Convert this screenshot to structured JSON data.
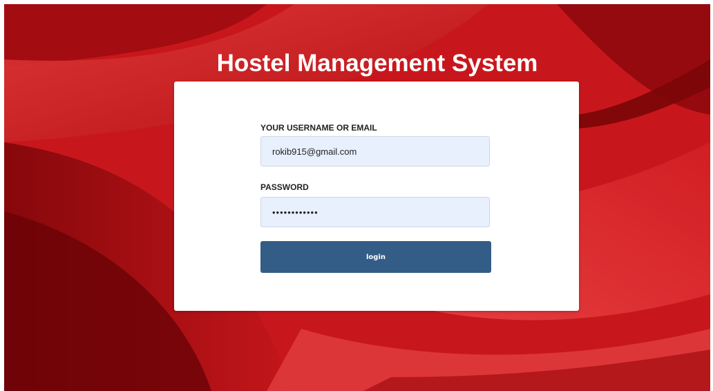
{
  "header": {
    "title": "Hostel Management System"
  },
  "login_form": {
    "username_label": "YOUR USERNAME OR EMAIL",
    "username_value": "rokib915@gmail.com",
    "password_label": "PASSWORD",
    "password_value": "passwordtext",
    "submit_label": "login"
  },
  "colors": {
    "background": "#c5151a",
    "card": "#ffffff",
    "input_fill": "#e8f0fe",
    "button": "#335d87"
  }
}
